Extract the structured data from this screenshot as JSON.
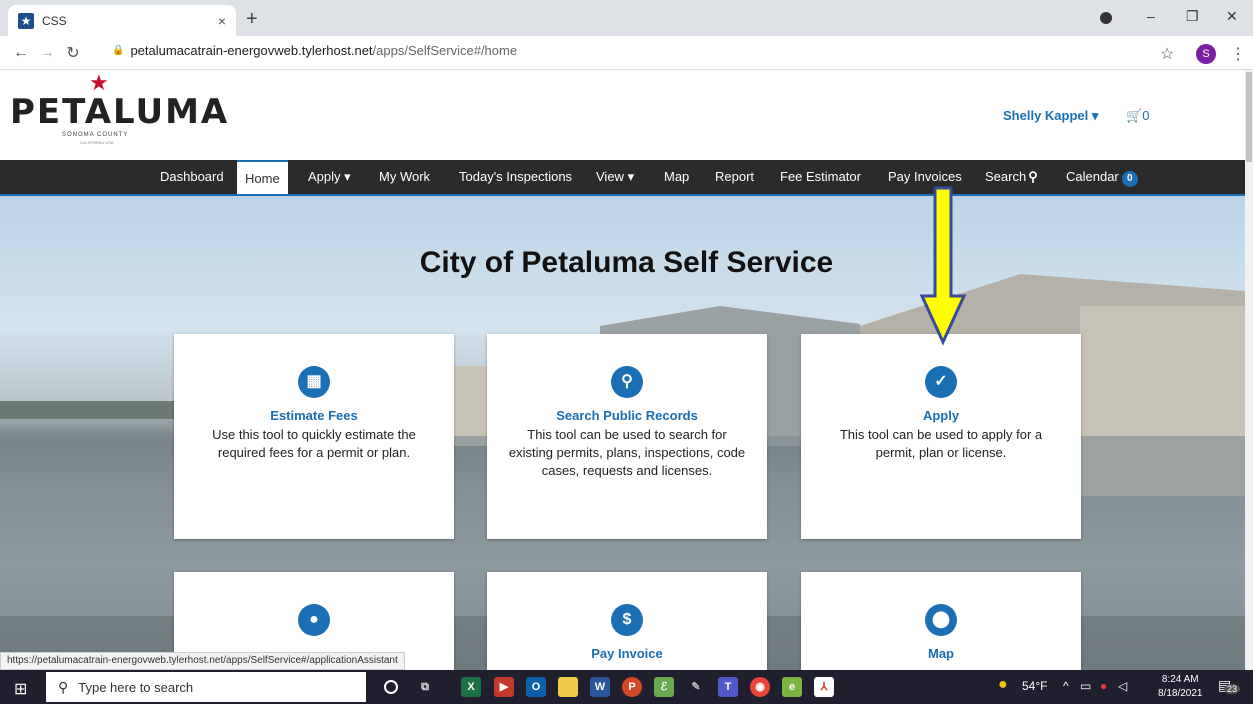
{
  "browser": {
    "tab_title": "CSS",
    "tab_close": "×",
    "new_tab": "+",
    "url_host": "petalumacatrain-energovweb.tylerhost.net",
    "url_path": "/apps/SelfService#/home",
    "profile_initial": "S",
    "win_min": "–",
    "win_max": "❐",
    "win_close": "✕"
  },
  "header": {
    "logo": "PETALUMA",
    "logo_sub": "SONOMA COUNTY",
    "logo_sub2": "CALIFORNIA·USA",
    "user_name": "Shelly Kappel",
    "cart_count": "0"
  },
  "nav": {
    "items": [
      {
        "label": "Dashboard"
      },
      {
        "label": "Home"
      },
      {
        "label": "Apply"
      },
      {
        "label": "My Work"
      },
      {
        "label": "Today's Inspections"
      },
      {
        "label": "View"
      },
      {
        "label": "Map"
      },
      {
        "label": "Report"
      },
      {
        "label": "Fee Estimator"
      },
      {
        "label": "Pay Invoices"
      },
      {
        "label": "Search"
      },
      {
        "label": "Calendar"
      }
    ],
    "calendar_badge": "0"
  },
  "hero": {
    "title": "City of Petaluma Self Service"
  },
  "cards": [
    {
      "title": "Estimate Fees",
      "icon": "calculator-icon",
      "desc": "Use this tool to quickly estimate the required fees for a permit or plan."
    },
    {
      "title": "Search Public Records",
      "icon": "search-icon",
      "desc": "This tool can be used to search for existing permits, plans, inspections, code cases, requests and licenses."
    },
    {
      "title": "Apply",
      "icon": "clipboard-check-icon",
      "desc": "This tool can be used to apply for a permit, plan or license."
    },
    {
      "title": "",
      "icon": "user-icon",
      "desc": ""
    },
    {
      "title": "Pay Invoice",
      "icon": "dollar-icon",
      "desc": ""
    },
    {
      "title": "Map",
      "icon": "map-marker-icon",
      "desc": ""
    }
  ],
  "status_url": "https://petalumacatrain-energovweb.tylerhost.net/apps/SelfService#/applicationAssistant",
  "taskbar": {
    "search_placeholder": "Type here to search",
    "weather": "54°F",
    "time": "8:24 AM",
    "date": "8/18/2021",
    "notif_count": "23"
  },
  "colors": {
    "accent": "#1a6fb5",
    "navbar": "#2b2b2b",
    "arrow": "#ffff00"
  }
}
